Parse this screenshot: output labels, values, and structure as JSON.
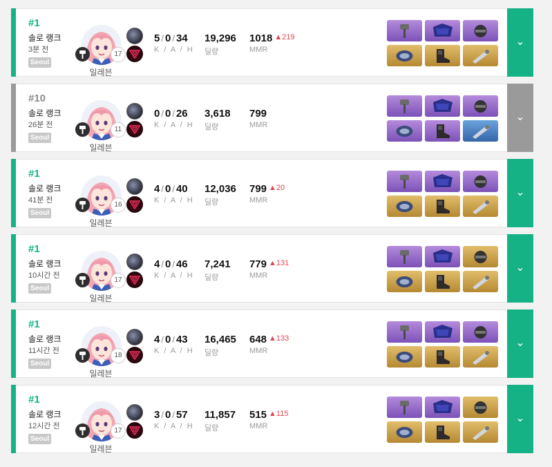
{
  "colors": {
    "win_accent": "#14b285",
    "loss_accent": "#9a9a9a",
    "mmr_up": "#e0444e",
    "item_epic": "#8c60c4",
    "item_legendary": "#c99b45",
    "item_rare": "#4a80c4"
  },
  "labels": {
    "kda": "K / A / H",
    "damage": "딜량",
    "mmr": "MMR",
    "expand_icon": "⌄",
    "weapon_icon": "hammer-icon",
    "trait_icons": [
      "trait-core-icon",
      "trait-sub-icon"
    ]
  },
  "matches": [
    {
      "result": "win",
      "rank": "#1",
      "mode": "솔로 랭크",
      "time_ago": "3분 전",
      "region": "Seoul",
      "character": "일레븐",
      "level": "17",
      "kills": "5",
      "assists": "0",
      "hunts": "34",
      "damage": "19,296",
      "mmr": "1018",
      "mmr_delta": "▲219",
      "items": [
        "epic",
        "epic",
        "epic",
        "legend",
        "legend",
        "legend"
      ]
    },
    {
      "result": "loss",
      "rank": "#10",
      "mode": "솔로 랭크",
      "time_ago": "26분 전",
      "region": "Seoul",
      "character": "일레븐",
      "level": "11",
      "kills": "0",
      "assists": "0",
      "hunts": "26",
      "damage": "3,618",
      "mmr": "799",
      "mmr_delta": "",
      "items": [
        "epic",
        "epic",
        "epic",
        "epic",
        "epic",
        "rare"
      ]
    },
    {
      "result": "win",
      "rank": "#1",
      "mode": "솔로 랭크",
      "time_ago": "41분 전",
      "region": "Seoul",
      "character": "일레븐",
      "level": "16",
      "kills": "4",
      "assists": "0",
      "hunts": "40",
      "damage": "12,036",
      "mmr": "799",
      "mmr_delta": "▲20",
      "items": [
        "epic",
        "epic",
        "epic",
        "legend",
        "legend",
        "legend"
      ]
    },
    {
      "result": "win",
      "rank": "#1",
      "mode": "솔로 랭크",
      "time_ago": "10시간 전",
      "region": "Seoul",
      "character": "일레븐",
      "level": "17",
      "kills": "4",
      "assists": "0",
      "hunts": "46",
      "damage": "7,241",
      "mmr": "779",
      "mmr_delta": "▲131",
      "items": [
        "epic",
        "epic",
        "legend",
        "legend",
        "legend",
        "legend"
      ]
    },
    {
      "result": "win",
      "rank": "#1",
      "mode": "솔로 랭크",
      "time_ago": "11시간 전",
      "region": "Seoul",
      "character": "일레븐",
      "level": "18",
      "kills": "4",
      "assists": "0",
      "hunts": "43",
      "damage": "16,465",
      "mmr": "648",
      "mmr_delta": "▲133",
      "items": [
        "epic",
        "epic",
        "epic",
        "legend",
        "legend",
        "legend"
      ]
    },
    {
      "result": "win",
      "rank": "#1",
      "mode": "솔로 랭크",
      "time_ago": "12시간 전",
      "region": "Seoul",
      "character": "일레븐",
      "level": "17",
      "kills": "3",
      "assists": "0",
      "hunts": "57",
      "damage": "11,857",
      "mmr": "515",
      "mmr_delta": "▲115",
      "items": [
        "epic",
        "epic",
        "legend",
        "legend",
        "legend",
        "legend"
      ]
    }
  ]
}
